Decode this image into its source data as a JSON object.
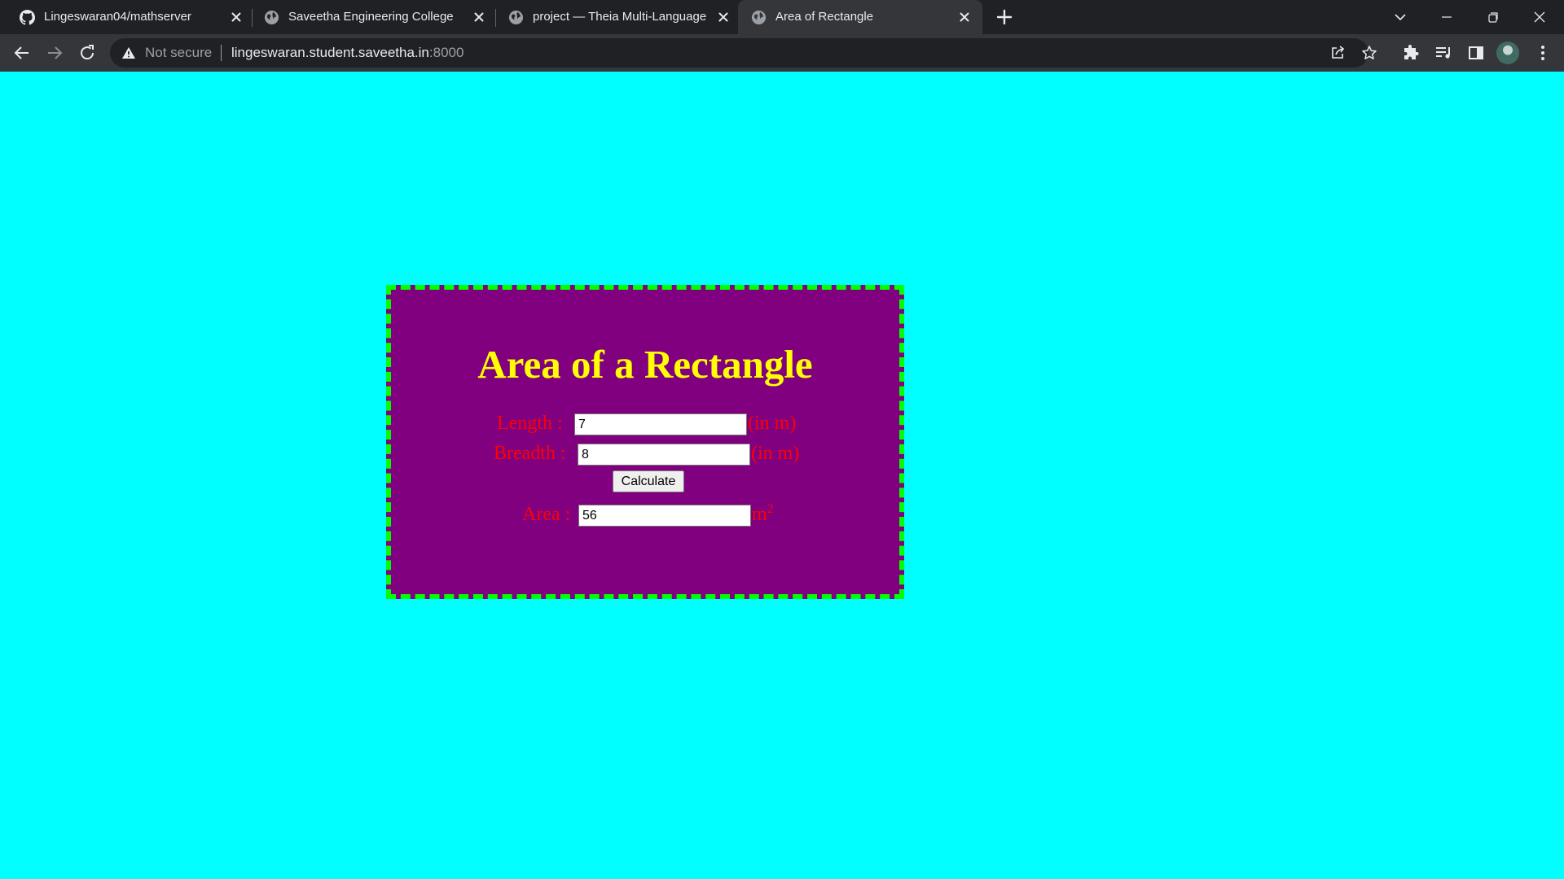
{
  "browser": {
    "tabs": [
      {
        "title": "Lingeswaran04/mathserver",
        "favicon": "github-icon",
        "active": false
      },
      {
        "title": "Saveetha Engineering College",
        "favicon": "globe-icon",
        "active": false
      },
      {
        "title": "project — Theia Multi-Language",
        "favicon": "globe-icon",
        "active": false
      },
      {
        "title": "Area of Rectangle",
        "favicon": "globe-icon",
        "active": true
      }
    ],
    "address_bar": {
      "security_label": "Not secure",
      "url_host": "lingeswaran.student.saveetha.in",
      "url_port": ":8000"
    },
    "colors": {
      "tabbar_bg": "#202124",
      "toolbar_bg": "#35363a",
      "omnibox_bg": "#202124"
    }
  },
  "page": {
    "title": "Area of a Rectangle",
    "length": {
      "label": "Length :",
      "value": "7",
      "unit": "(in m)"
    },
    "breadth": {
      "label": "Breadth :",
      "value": "8",
      "unit": "(in m)"
    },
    "calculate_label": "Calculate",
    "area": {
      "label": "Area :",
      "value": "56",
      "unit_base": "m",
      "unit_exp": "2"
    },
    "colors": {
      "background": "#00ffff",
      "card": "#800080",
      "border": "#00ff00",
      "title": "#ffff00",
      "labels": "#ff0000"
    }
  }
}
